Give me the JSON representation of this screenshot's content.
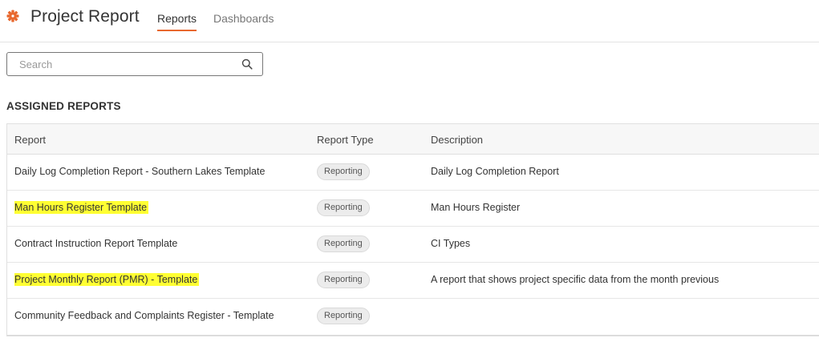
{
  "header": {
    "title": "Project Report",
    "tabs": [
      {
        "label": "Reports",
        "active": true
      },
      {
        "label": "Dashboards",
        "active": false
      }
    ],
    "accent_color": "#e8682e"
  },
  "search": {
    "placeholder": "Search",
    "value": ""
  },
  "section": {
    "title": "ASSIGNED REPORTS"
  },
  "table": {
    "columns": [
      "Report",
      "Report Type",
      "Description"
    ],
    "rows": [
      {
        "report": "Daily Log Completion Report - Southern Lakes Template",
        "type": "Reporting",
        "description": "Daily Log Completion Report",
        "highlighted": false
      },
      {
        "report": "Man Hours Register Template",
        "type": "Reporting",
        "description": "Man Hours Register",
        "highlighted": true
      },
      {
        "report": "Contract Instruction Report Template",
        "type": "Reporting",
        "description": "CI Types",
        "highlighted": false
      },
      {
        "report": "Project Monthly Report (PMR) - Template",
        "type": "Reporting",
        "description": "A report that shows project specific data from the month previous",
        "highlighted": true
      },
      {
        "report": "Community Feedback and Complaints Register - Template",
        "type": "Reporting",
        "description": "",
        "highlighted": false
      }
    ],
    "highlight_color": "#ffff33"
  }
}
